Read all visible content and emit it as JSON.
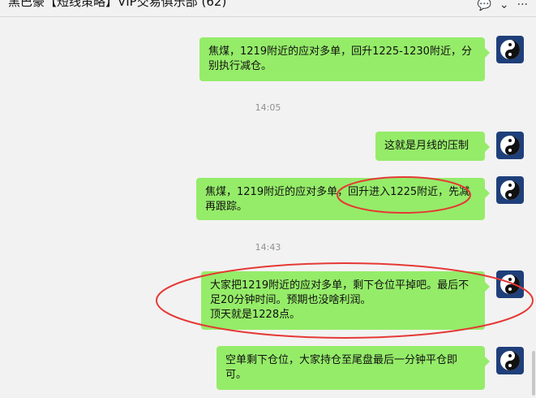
{
  "header": {
    "title": "黑巴豪【短线策略】VIP交易俱乐部 (62)",
    "icons": [
      "chat-bubble-icon",
      "chevron-down-icon",
      "menu-icon"
    ]
  },
  "messages": [
    {
      "type": "bubble",
      "text": "焦煤，1219附近的应对多单，回升1225-1230附近，分别执行减仓。"
    },
    {
      "type": "time",
      "text": "14:05"
    },
    {
      "type": "bubble",
      "text": "这就是月线的压制"
    },
    {
      "type": "bubble",
      "text": "焦煤，1219附近的应对多单，回升进入1225附近，先减再跟踪。"
    },
    {
      "type": "time",
      "text": "14:43"
    },
    {
      "type": "bubble",
      "text": "大家把1219附近的应对多单，剩下仓位平掉吧。最后不足20分钟时间。预期也没啥利润。\n顶天就是1228点。"
    },
    {
      "type": "bubble",
      "text": "空单剩下仓位，大家持仓至尾盘最后一分钟平仓即可。"
    }
  ],
  "colors": {
    "bubble": "#95ec69",
    "annotation": "#e53935",
    "background": "#f2f2f2"
  }
}
